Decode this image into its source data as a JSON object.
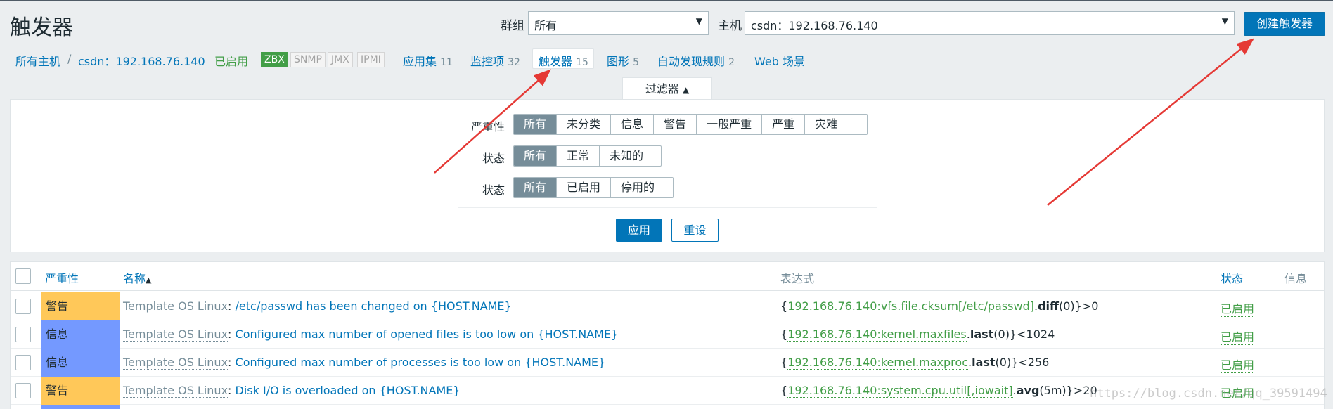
{
  "header": {
    "title": "触发器",
    "group_label": "群组",
    "group_value": "所有",
    "host_label": "主机",
    "host_value": "csdn：192.168.76.140",
    "create_button": "创建触发器"
  },
  "nav": {
    "all_hosts": "所有主机",
    "separator": "/",
    "host": "csdn：192.168.76.140",
    "status": "已启用",
    "badges": [
      "ZBX",
      "SNMP",
      "JMX",
      "IPMI"
    ],
    "links": [
      {
        "label": "应用集",
        "count": "11"
      },
      {
        "label": "监控项",
        "count": "32"
      },
      {
        "label": "触发器",
        "count": "15"
      },
      {
        "label": "图形",
        "count": "5"
      },
      {
        "label": "自动发现规则",
        "count": "2"
      },
      {
        "label": "Web 场景",
        "count": ""
      }
    ]
  },
  "filter": {
    "tab_label": "过滤器",
    "tab_arrow": "▲",
    "rows": [
      {
        "label": "严重性",
        "options": [
          "所有",
          "未分类",
          "信息",
          "警告",
          "一般严重",
          "严重",
          "灾难"
        ]
      },
      {
        "label": "状态",
        "options": [
          "所有",
          "正常",
          "未知的"
        ]
      },
      {
        "label": "状态",
        "options": [
          "所有",
          "已启用",
          "停用的"
        ]
      }
    ],
    "apply": "应用",
    "reset": "重设"
  },
  "table": {
    "columns": {
      "severity": "严重性",
      "name": "名称",
      "sort_arrow": "▲",
      "expression": "表达式",
      "status": "状态",
      "info": "信息"
    },
    "rows": [
      {
        "severity": "警告",
        "sev_class": "warn",
        "template": "Template OS Linux",
        "name": "/etc/passwd has been changed on {HOST.NAME}",
        "expr_open": "{",
        "expr_item": "192.168.76.140:vfs.file.cksum[/etc/passwd]",
        "expr_func": "diff",
        "expr_rest": "(0)}>0",
        "status": "已启用"
      },
      {
        "severity": "信息",
        "sev_class": "info",
        "template": "Template OS Linux",
        "name": "Configured max number of opened files is too low on {HOST.NAME}",
        "expr_open": "{",
        "expr_item": "192.168.76.140:kernel.maxfiles",
        "expr_func": "last",
        "expr_rest": "(0)}<1024",
        "status": "已启用"
      },
      {
        "severity": "信息",
        "sev_class": "info",
        "template": "Template OS Linux",
        "name": "Configured max number of processes is too low on {HOST.NAME}",
        "expr_open": "{",
        "expr_item": "192.168.76.140:kernel.maxproc",
        "expr_func": "last",
        "expr_rest": "(0)}<256",
        "status": "已启用"
      },
      {
        "severity": "警告",
        "sev_class": "warn",
        "template": "Template OS Linux",
        "name": "Disk I/O is overloaded on {HOST.NAME}",
        "expr_open": "{",
        "expr_item": "192.168.76.140:system.cpu.util[,iowait]",
        "expr_func": "avg",
        "expr_rest": "(5m)}>20",
        "status": "已启用"
      }
    ]
  },
  "watermark": "https://blog.csdn.net/qq_39591494",
  "colors": {
    "accent": "#0275b8",
    "enabled": "#429e47",
    "warning": "#ffc859",
    "information": "#7499ff",
    "arrow": "#e53935"
  }
}
